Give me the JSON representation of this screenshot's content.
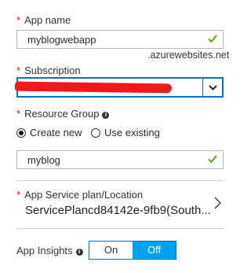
{
  "app_name": {
    "label": "App name",
    "value": "myblogwebapp",
    "suffix": ".azurewebsites.net"
  },
  "subscription": {
    "label": "Subscription"
  },
  "resource_group": {
    "label": "Resource Group",
    "info_glyph": "i",
    "create_new": "Create new",
    "use_existing": "Use existing",
    "selected": "create_new",
    "value": "myblog"
  },
  "app_service_plan": {
    "label": "App Service plan/Location",
    "value": "ServicePlancd84142e-9fb9(South..."
  },
  "app_insights": {
    "label": "App Insights",
    "info_glyph": "i",
    "on_label": "On",
    "off_label": "Off",
    "selected": "off"
  },
  "required_marker": "*",
  "colors": {
    "accent": "#0072c6",
    "toggle_selected": "#00a1f1",
    "required": "#e81123",
    "valid_check": "#57a300",
    "redaction": "#f01818"
  },
  "icons": {
    "valid": "check-icon",
    "dropdown": "chevron-down-icon",
    "navigate": "chevron-right-icon",
    "info": "info-icon"
  }
}
